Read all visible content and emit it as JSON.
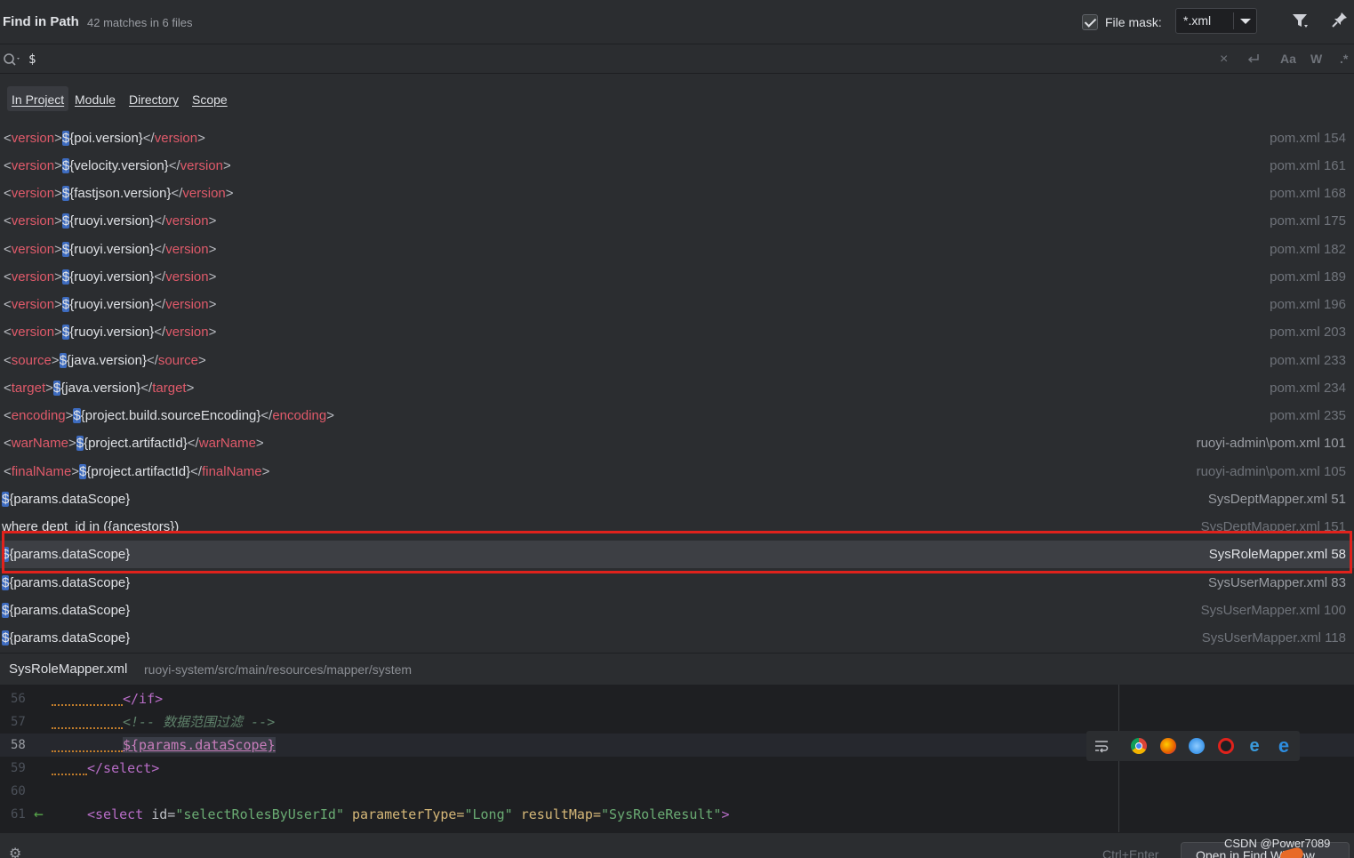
{
  "header": {
    "title": "Find in Path",
    "subtitle": "42 matches in 6 files",
    "file_mask_label": "File mask:",
    "file_mask_value": "*.xml",
    "icons": [
      "filter-icon",
      "pin-icon"
    ]
  },
  "search": {
    "value": "$",
    "tool_labels": [
      "Aa",
      "W",
      ".*"
    ]
  },
  "scope_tabs": [
    "In Project",
    "Module",
    "Directory",
    "Scope"
  ],
  "results": [
    {
      "tag": "version",
      "expr": "{poi.version}",
      "file": "pom.xml 154"
    },
    {
      "tag": "version",
      "expr": "{velocity.version}",
      "file": "pom.xml 161"
    },
    {
      "tag": "version",
      "expr": "{fastjson.version}",
      "file": "pom.xml 168"
    },
    {
      "tag": "version",
      "expr": "{ruoyi.version}",
      "file": "pom.xml 175"
    },
    {
      "tag": "version",
      "expr": "{ruoyi.version}",
      "file": "pom.xml 182"
    },
    {
      "tag": "version",
      "expr": "{ruoyi.version}",
      "file": "pom.xml 189"
    },
    {
      "tag": "version",
      "expr": "{ruoyi.version}",
      "file": "pom.xml 196"
    },
    {
      "tag": "version",
      "expr": "{ruoyi.version}",
      "file": "pom.xml 203"
    },
    {
      "tag": "source",
      "expr": "{java.version}",
      "file": "pom.xml 233"
    },
    {
      "tag": "target",
      "expr": "{java.version}",
      "file": "pom.xml 234"
    },
    {
      "tag": "encoding",
      "expr": "{project.build.sourceEncoding}",
      "file": "pom.xml 235"
    },
    {
      "tag": "warName",
      "expr": "{project.artifactId}",
      "file": "ruoyi-admin\\pom.xml 101"
    },
    {
      "tag": "finalName",
      "expr": "{project.artifactId}",
      "file": "ruoyi-admin\\pom.xml 105"
    },
    {
      "tag": "",
      "expr": "{params.dataScope}",
      "file": "SysDeptMapper.xml 51"
    },
    {
      "tag": "",
      "expr": "where dept_id in ({ancestors})",
      "file": "SysDeptMapper.xml 151"
    },
    {
      "tag": "",
      "expr": "{params.dataScope}",
      "file": "SysRoleMapper.xml 58"
    },
    {
      "tag": "",
      "expr": "{params.dataScope}",
      "file": "SysUserMapper.xml 83"
    },
    {
      "tag": "",
      "expr": "{params.dataScope}",
      "file": "SysUserMapper.xml 100"
    },
    {
      "tag": "",
      "expr": "{params.dataScope}",
      "file": "SysUserMapper.xml 118"
    }
  ],
  "preview": {
    "file": "SysRoleMapper.xml",
    "path": "ruoyi-system/src/main/resources/mapper/system"
  },
  "editor": {
    "lines": [
      "56",
      "57",
      "58",
      "59",
      "60",
      "61"
    ],
    "line56": "</if>",
    "line57": "<!-- 数据范围过滤 -->",
    "line58": "${params.dataScope}",
    "line59": "</select>",
    "line61_tag": "<select",
    "line61_attr1": "id=",
    "line61_val1": "\"selectRolesByUserId\"",
    "line61_attr2": "parameterType=",
    "line61_val2": "\"Long\"",
    "line61_attr3": "resultMap=",
    "line61_val3": "\"SysRoleResult\"",
    "line61_close": ">"
  },
  "footer": {
    "shortcut": "Ctrl+Enter",
    "open_button": "Open in Find Window"
  },
  "watermark": "CSDN @Power7089",
  "colors": {
    "background": "#2b2d30",
    "editor_bg": "#1e1f22",
    "tag_red": "#e05a6a",
    "match_blue": "#3d6bbf",
    "highlight_frame": "#e0221c"
  }
}
